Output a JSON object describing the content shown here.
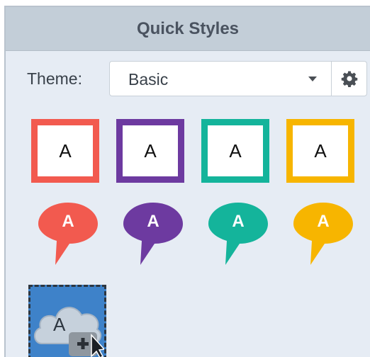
{
  "panel": {
    "title": "Quick Styles",
    "theme_label": "Theme:",
    "theme_value": "Basic"
  },
  "box_styles": [
    {
      "label": "A",
      "color": "#f25a4f"
    },
    {
      "label": "A",
      "color": "#6d3aa0"
    },
    {
      "label": "A",
      "color": "#14b49b"
    },
    {
      "label": "A",
      "color": "#f7b500"
    }
  ],
  "bubble_styles": [
    {
      "label": "A",
      "color": "#f25a4f"
    },
    {
      "label": "A",
      "color": "#6d3aa0"
    },
    {
      "label": "A",
      "color": "#14b49b"
    },
    {
      "label": "A",
      "color": "#f7b500"
    }
  ],
  "custom_style": {
    "label": "A",
    "color": "#3e82c9"
  }
}
